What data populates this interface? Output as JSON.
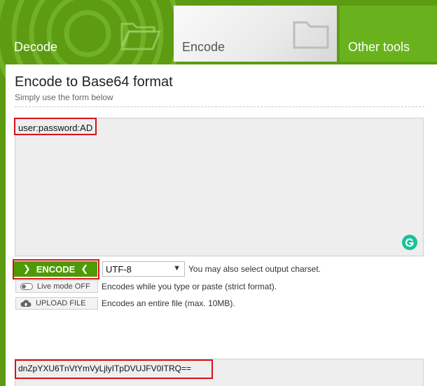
{
  "tabs": {
    "decode": "Decode",
    "encode": "Encode",
    "other": "Other tools"
  },
  "panel": {
    "title": "Encode to Base64 format",
    "subtitle": "Simply use the form below"
  },
  "input": {
    "value": "user:password:AD"
  },
  "encode_button": {
    "label": "ENCODE"
  },
  "charset": {
    "selected": "UTF-8",
    "note": "You may also select output charset."
  },
  "live_mode": {
    "label": "Live mode OFF",
    "note": "Encodes while you type or paste (strict format)."
  },
  "upload": {
    "label": "UPLOAD FILE",
    "note": "Encodes an entire file (max. 10MB)."
  },
  "output": {
    "value": "dnZpYXU6TnVtYmVyLjlyITpDVUJFV0ITRQ=="
  },
  "colors": {
    "brand_green": "#4e9a06",
    "highlight_red": "#d4141a",
    "grammarly": "#15c39a"
  }
}
